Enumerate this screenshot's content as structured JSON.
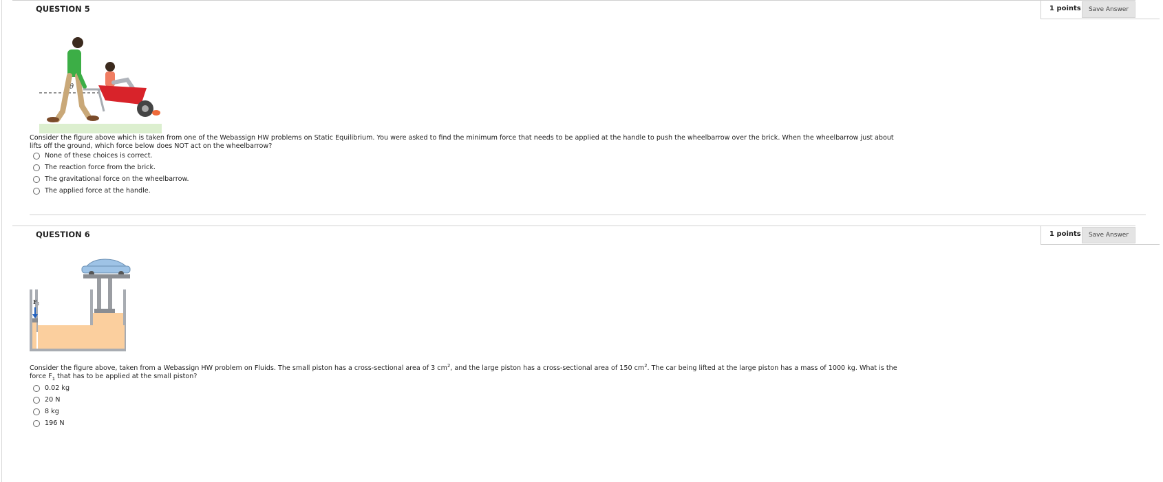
{
  "questions": [
    {
      "title": "QUESTION 5",
      "points": "1 points",
      "save_label": "Save Answer",
      "text": "Consider the figure above which is taken from one of the Webassign HW problems on Static Equilibrium. You were asked to find the minimum force that needs to be applied at the handle to push the wheelbarrow over the brick. When the wheelbarrow just about lifts off the ground, which force below does NOT act on the wheelbarrow?",
      "choices": [
        "None of these choices is correct.",
        "The reaction force from the brick.",
        "The gravitational force on the wheelbarrow.",
        "The applied force at the handle."
      ],
      "figure": {
        "angle_label": "θ",
        "description": "wheelbarrow-figure"
      }
    },
    {
      "title": "QUESTION 6",
      "points": "1 points",
      "save_label": "Save Answer",
      "text_parts": {
        "p1": "Consider the figure above, taken from a Webassign HW problem on Fluids. The small piston has a cross-sectional area of 3 cm",
        "sup1": "2",
        "p2": ", and the large piston has a cross-sectional area of 150 cm",
        "sup2": "2",
        "p3": ". The car being lifted at the large piston has a mass of 1000 kg. What is the force F",
        "sub1": "1",
        "p4": " that has to be applied at the small piston?"
      },
      "choices": [
        "0.02 kg",
        "20 N",
        "8 kg",
        "196 N"
      ],
      "figure": {
        "force_label": "F",
        "force_sub": "1"
      }
    }
  ],
  "colors": {
    "rule": "#cfcfcf",
    "button_bg": "#e4e4e4",
    "fluid": "#fbcf9e",
    "car": "#9ec3e6",
    "barrow": "#d8232a",
    "shirt": "#3cae46"
  }
}
